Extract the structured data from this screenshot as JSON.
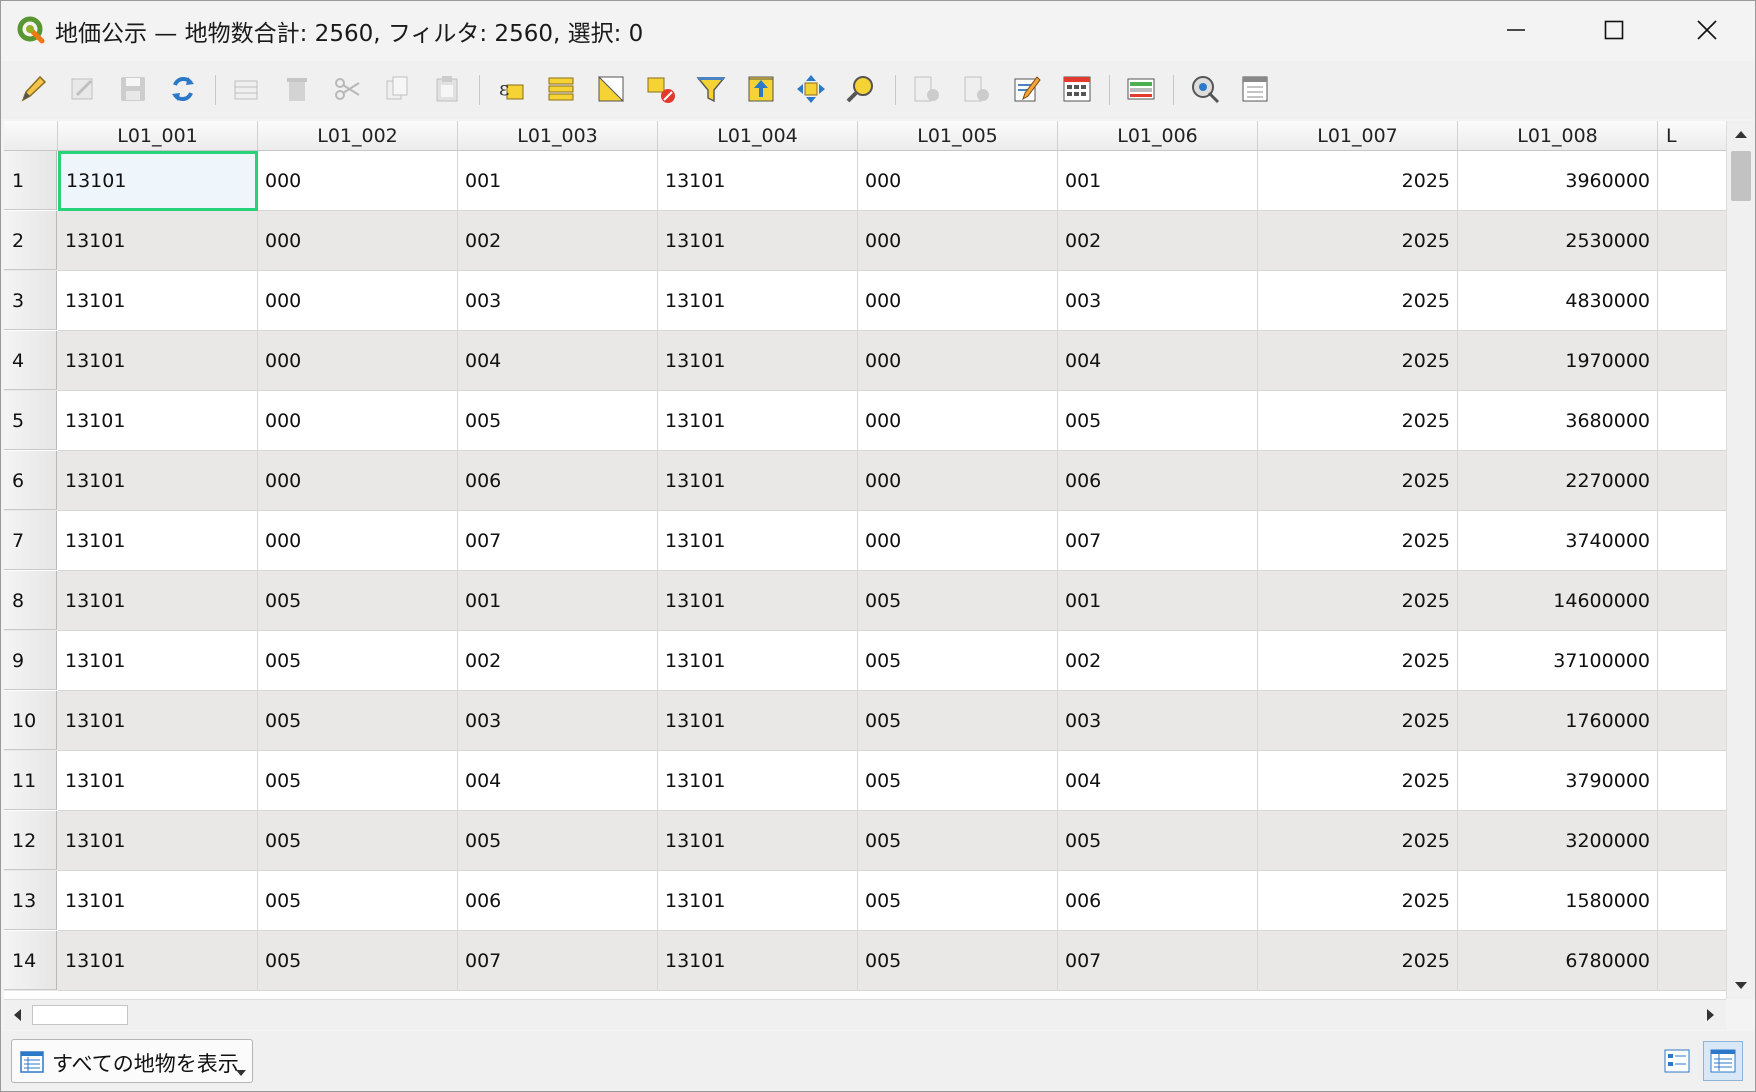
{
  "window": {
    "title": "地価公示 — 地物数合計: 2560, フィルタ: 2560, 選択: 0"
  },
  "toolbar": {
    "icons": [
      "pencil-icon",
      "multi-edit-icon",
      "save-icon",
      "reload-icon",
      "add-feature-icon",
      "delete-icon",
      "cut-icon",
      "copy-icon",
      "paste-icon",
      "select-by-expression-icon",
      "select-all-icon",
      "invert-selection-icon",
      "deselect-icon",
      "filter-icon",
      "move-selection-to-top-icon",
      "pan-to-selection-icon",
      "zoom-to-selection-icon",
      "new-field-icon",
      "delete-field-icon",
      "conditional-formatting-icon",
      "field-calculator-icon",
      "organize-columns-icon",
      "actions-icon",
      "dock-icon"
    ]
  },
  "table": {
    "columns": [
      "L01_001",
      "L01_002",
      "L01_003",
      "L01_004",
      "L01_005",
      "L01_006",
      "L01_007",
      "L01_008",
      "L"
    ],
    "rows": [
      {
        "num": "1",
        "cells": [
          "13101",
          "000",
          "001",
          "13101",
          "000",
          "001",
          "2025",
          "3960000"
        ]
      },
      {
        "num": "2",
        "cells": [
          "13101",
          "000",
          "002",
          "13101",
          "000",
          "002",
          "2025",
          "2530000"
        ]
      },
      {
        "num": "3",
        "cells": [
          "13101",
          "000",
          "003",
          "13101",
          "000",
          "003",
          "2025",
          "4830000"
        ]
      },
      {
        "num": "4",
        "cells": [
          "13101",
          "000",
          "004",
          "13101",
          "000",
          "004",
          "2025",
          "1970000"
        ]
      },
      {
        "num": "5",
        "cells": [
          "13101",
          "000",
          "005",
          "13101",
          "000",
          "005",
          "2025",
          "3680000"
        ]
      },
      {
        "num": "6",
        "cells": [
          "13101",
          "000",
          "006",
          "13101",
          "000",
          "006",
          "2025",
          "2270000"
        ]
      },
      {
        "num": "7",
        "cells": [
          "13101",
          "000",
          "007",
          "13101",
          "000",
          "007",
          "2025",
          "3740000"
        ]
      },
      {
        "num": "8",
        "cells": [
          "13101",
          "005",
          "001",
          "13101",
          "005",
          "001",
          "2025",
          "14600000"
        ]
      },
      {
        "num": "9",
        "cells": [
          "13101",
          "005",
          "002",
          "13101",
          "005",
          "002",
          "2025",
          "37100000"
        ]
      },
      {
        "num": "10",
        "cells": [
          "13101",
          "005",
          "003",
          "13101",
          "005",
          "003",
          "2025",
          "1760000"
        ]
      },
      {
        "num": "11",
        "cells": [
          "13101",
          "005",
          "004",
          "13101",
          "005",
          "004",
          "2025",
          "3790000"
        ]
      },
      {
        "num": "12",
        "cells": [
          "13101",
          "005",
          "005",
          "13101",
          "005",
          "005",
          "2025",
          "3200000"
        ]
      },
      {
        "num": "13",
        "cells": [
          "13101",
          "005",
          "006",
          "13101",
          "005",
          "006",
          "2025",
          "1580000"
        ]
      },
      {
        "num": "14",
        "cells": [
          "13101",
          "005",
          "007",
          "13101",
          "005",
          "007",
          "2025",
          "6780000"
        ]
      }
    ]
  },
  "bottom": {
    "filter_label": "すべての地物を表示"
  },
  "colors": {
    "selection_border": "#28d27a",
    "alt_row": "#e9e8e6"
  }
}
